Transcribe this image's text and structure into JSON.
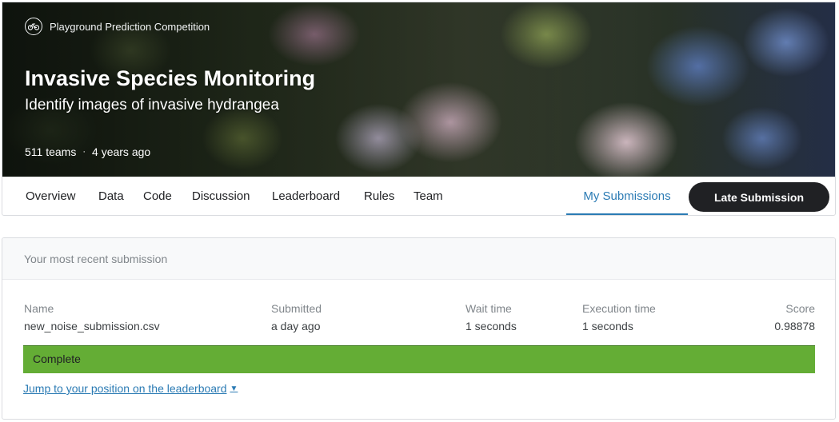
{
  "competition": {
    "type_label": "Playground Prediction Competition",
    "type_icon": "bicycle-icon",
    "title": "Invasive Species Monitoring",
    "subtitle": "Identify images of invasive hydrangea",
    "teams": "511 teams",
    "separator": "·",
    "age": "4 years ago"
  },
  "tabs": [
    {
      "label": "Overview"
    },
    {
      "label": "Data"
    },
    {
      "label": "Code"
    },
    {
      "label": "Discussion"
    },
    {
      "label": "Leaderboard"
    },
    {
      "label": "Rules"
    },
    {
      "label": "Team"
    },
    {
      "label": "My Submissions",
      "active": true
    }
  ],
  "late_submission_label": "Late Submission",
  "submission": {
    "heading": "Your most recent submission",
    "columns": {
      "name": {
        "label": "Name",
        "value": "new_noise_submission.csv"
      },
      "submitted": {
        "label": "Submitted",
        "value": "a day ago"
      },
      "wait": {
        "label": "Wait time",
        "value": "1 seconds"
      },
      "execution": {
        "label": "Execution time",
        "value": "1 seconds"
      },
      "score": {
        "label": "Score",
        "value": "0.98878"
      }
    },
    "status": "Complete",
    "status_color": "#64ad35",
    "jump_link": "Jump to your position on the leaderboard",
    "jump_icon": "caret-down-icon"
  },
  "colors": {
    "accent": "#2b7bb4",
    "button_bg": "#202124"
  }
}
